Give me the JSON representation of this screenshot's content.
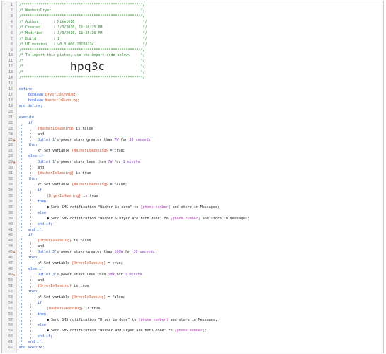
{
  "import_code": "hpq3c",
  "lines": [
    {
      "n": "1",
      "indent": 0,
      "bp": false,
      "parts": [
        {
          "t": "/*********************************************************/",
          "c": "comment"
        }
      ]
    },
    {
      "n": "2",
      "indent": 0,
      "bp": false,
      "parts": [
        {
          "t": "/* Washer/Dryer                                          */",
          "c": "comment"
        }
      ]
    },
    {
      "n": "3",
      "indent": 0,
      "bp": false,
      "parts": [
        {
          "t": "/*********************************************************/",
          "c": "comment"
        }
      ]
    },
    {
      "n": "4",
      "indent": 0,
      "bp": false,
      "parts": [
        {
          "t": "/* Author       : Mike1616                                */",
          "c": "comment"
        }
      ]
    },
    {
      "n": "5",
      "indent": 0,
      "bp": false,
      "parts": [
        {
          "t": "/* Created      : 3/3/2018, 11:16:25 PM                   */",
          "c": "comment"
        }
      ]
    },
    {
      "n": "6",
      "indent": 0,
      "bp": false,
      "parts": [
        {
          "t": "/* Modified     : 3/3/2018, 11:25:16 PM                   */",
          "c": "comment"
        }
      ]
    },
    {
      "n": "7",
      "indent": 0,
      "bp": false,
      "parts": [
        {
          "t": "/* Build        : 1                                       */",
          "c": "comment"
        }
      ]
    },
    {
      "n": "8",
      "indent": 0,
      "bp": false,
      "parts": [
        {
          "t": "/* UI version   : v0.3.000.20180224                       */",
          "c": "comment"
        }
      ]
    },
    {
      "n": "9",
      "indent": 0,
      "bp": false,
      "parts": [
        {
          "t": "/*********************************************************/",
          "c": "comment"
        }
      ]
    },
    {
      "n": "10",
      "indent": 0,
      "bp": false,
      "parts": [
        {
          "t": "/* To import this piston, use the import code below:     */",
          "c": "comment"
        }
      ]
    },
    {
      "n": "11",
      "indent": 0,
      "bp": false,
      "parts": [
        {
          "t": "/*                                                       */",
          "c": "comment"
        }
      ]
    },
    {
      "n": "12",
      "indent": 0,
      "bp": false,
      "parts": [
        {
          "t": "/*                                                       */",
          "c": "comment"
        }
      ]
    },
    {
      "n": "13",
      "indent": 0,
      "bp": false,
      "parts": [
        {
          "t": "/*                                                       */",
          "c": "comment"
        }
      ]
    },
    {
      "n": "14",
      "indent": 0,
      "bp": false,
      "parts": [
        {
          "t": "/*********************************************************/",
          "c": "comment"
        }
      ]
    },
    {
      "n": "15",
      "indent": 0,
      "bp": false,
      "parts": []
    },
    {
      "n": "16",
      "indent": 0,
      "bp": false,
      "parts": [
        {
          "t": "define",
          "c": "kw"
        }
      ]
    },
    {
      "n": "17",
      "indent": 2,
      "bp": false,
      "parts": [
        {
          "t": "boolean ",
          "c": "kw"
        },
        {
          "t": "DryerIsRunning",
          "c": "var"
        },
        {
          "t": ";",
          "c": "text"
        }
      ]
    },
    {
      "n": "18",
      "indent": 2,
      "bp": false,
      "parts": [
        {
          "t": "boolean ",
          "c": "kw"
        },
        {
          "t": "WasherIsRunning",
          "c": "var"
        },
        {
          "t": ";",
          "c": "text"
        }
      ]
    },
    {
      "n": "19",
      "indent": 0,
      "bp": false,
      "parts": [
        {
          "t": "end define;",
          "c": "kw"
        }
      ]
    },
    {
      "n": "20",
      "indent": 0,
      "bp": false,
      "parts": []
    },
    {
      "n": "21",
      "indent": 0,
      "bp": false,
      "parts": [
        {
          "t": "execute",
          "c": "kw"
        }
      ]
    },
    {
      "n": "22",
      "indent": 2,
      "bp": false,
      "parts": [
        {
          "t": "if",
          "c": "kw"
        }
      ]
    },
    {
      "n": "23",
      "indent": 4,
      "bp": false,
      "parts": [
        {
          "t": "{WasherIsRunning}",
          "c": "var"
        },
        {
          "t": " is false",
          "c": "text"
        }
      ]
    },
    {
      "n": "24",
      "indent": 4,
      "bp": false,
      "parts": [
        {
          "t": "and",
          "c": "text"
        }
      ]
    },
    {
      "n": "25",
      "indent": 4,
      "bp": true,
      "parts": [
        {
          "t": "Outlet 1",
          "c": "kw"
        },
        {
          "t": "'s power stays greater than ",
          "c": "text"
        },
        {
          "t": "7W",
          "c": "num"
        },
        {
          "t": " for ",
          "c": "text"
        },
        {
          "t": "30 seconds",
          "c": "num"
        }
      ]
    },
    {
      "n": "26",
      "indent": 2,
      "bp": false,
      "parts": [
        {
          "t": "then",
          "c": "kw"
        }
      ]
    },
    {
      "n": "27",
      "indent": 4,
      "bp": false,
      "parts": [
        {
          "t": "x² Set variable ",
          "c": "text"
        },
        {
          "t": "{WasherIsRunning}",
          "c": "var"
        },
        {
          "t": " = true;",
          "c": "text"
        }
      ]
    },
    {
      "n": "28",
      "indent": 2,
      "bp": false,
      "parts": [
        {
          "t": "else if",
          "c": "kw"
        }
      ]
    },
    {
      "n": "29",
      "indent": 4,
      "bp": true,
      "parts": [
        {
          "t": "Outlet 1",
          "c": "kw"
        },
        {
          "t": "'s power stays less than ",
          "c": "text"
        },
        {
          "t": "7W",
          "c": "num"
        },
        {
          "t": " for ",
          "c": "text"
        },
        {
          "t": "1 minute",
          "c": "num"
        }
      ]
    },
    {
      "n": "30",
      "indent": 4,
      "bp": false,
      "parts": [
        {
          "t": "and",
          "c": "text"
        }
      ]
    },
    {
      "n": "31",
      "indent": 4,
      "bp": false,
      "parts": [
        {
          "t": "{WasherIsRunning}",
          "c": "var"
        },
        {
          "t": " is true",
          "c": "text"
        }
      ]
    },
    {
      "n": "32",
      "indent": 2,
      "bp": false,
      "parts": [
        {
          "t": "then",
          "c": "kw"
        }
      ]
    },
    {
      "n": "33",
      "indent": 4,
      "bp": false,
      "parts": [
        {
          "t": "x² Set variable ",
          "c": "text"
        },
        {
          "t": "{WasherIsRunning}",
          "c": "var"
        },
        {
          "t": " = false;",
          "c": "text"
        }
      ]
    },
    {
      "n": "34",
      "indent": 4,
      "bp": false,
      "parts": [
        {
          "t": "if",
          "c": "kw"
        }
      ]
    },
    {
      "n": "35",
      "indent": 6,
      "bp": false,
      "parts": [
        {
          "t": "{DryerIsRunning}",
          "c": "var"
        },
        {
          "t": " is true",
          "c": "text"
        }
      ]
    },
    {
      "n": "36",
      "indent": 4,
      "bp": false,
      "parts": [
        {
          "t": "then",
          "c": "kw"
        }
      ]
    },
    {
      "n": "37",
      "indent": 6,
      "bp": false,
      "parts": [
        {
          "t": "● Send SMS notification \"Washer is done\" to ",
          "c": "text"
        },
        {
          "t": "[phone number]",
          "c": "arg"
        },
        {
          "t": " and store in Messages;",
          "c": "text"
        }
      ]
    },
    {
      "n": "38",
      "indent": 4,
      "bp": false,
      "parts": [
        {
          "t": "else",
          "c": "kw"
        }
      ]
    },
    {
      "n": "39",
      "indent": 6,
      "bp": false,
      "parts": [
        {
          "t": "● Send SMS notification \"Washer & Dryer are both done\" to ",
          "c": "text"
        },
        {
          "t": "[phone number]",
          "c": "arg"
        },
        {
          "t": " and store in Messages;",
          "c": "text"
        }
      ]
    },
    {
      "n": "40",
      "indent": 4,
      "bp": false,
      "parts": [
        {
          "t": "end if;",
          "c": "kw"
        }
      ]
    },
    {
      "n": "41",
      "indent": 2,
      "bp": false,
      "parts": [
        {
          "t": "end if;",
          "c": "kw"
        }
      ]
    },
    {
      "n": "42",
      "indent": 2,
      "bp": false,
      "parts": [
        {
          "t": "if",
          "c": "kw"
        }
      ]
    },
    {
      "n": "43",
      "indent": 4,
      "bp": false,
      "parts": [
        {
          "t": "{DryerIsRunning}",
          "c": "var"
        },
        {
          "t": " is false",
          "c": "text"
        }
      ]
    },
    {
      "n": "44",
      "indent": 4,
      "bp": false,
      "parts": [
        {
          "t": "and",
          "c": "text"
        }
      ]
    },
    {
      "n": "45",
      "indent": 4,
      "bp": true,
      "parts": [
        {
          "t": "Outlet 3",
          "c": "kw"
        },
        {
          "t": "'s power stays greater than ",
          "c": "text"
        },
        {
          "t": "100W",
          "c": "num"
        },
        {
          "t": " for ",
          "c": "text"
        },
        {
          "t": "30 seconds",
          "c": "num"
        }
      ]
    },
    {
      "n": "46",
      "indent": 2,
      "bp": false,
      "parts": [
        {
          "t": "then",
          "c": "kw"
        }
      ]
    },
    {
      "n": "47",
      "indent": 4,
      "bp": false,
      "parts": [
        {
          "t": "x² Set variable ",
          "c": "text"
        },
        {
          "t": "{DryerIsRunning}",
          "c": "var"
        },
        {
          "t": " = true;",
          "c": "text"
        }
      ]
    },
    {
      "n": "48",
      "indent": 2,
      "bp": false,
      "parts": [
        {
          "t": "else if",
          "c": "kw"
        }
      ]
    },
    {
      "n": "49",
      "indent": 4,
      "bp": true,
      "parts": [
        {
          "t": "Outlet 3",
          "c": "kw"
        },
        {
          "t": "'s power stays less than ",
          "c": "text"
        },
        {
          "t": "10W",
          "c": "num"
        },
        {
          "t": " for ",
          "c": "text"
        },
        {
          "t": "1 minute",
          "c": "num"
        }
      ]
    },
    {
      "n": "50",
      "indent": 4,
      "bp": false,
      "parts": [
        {
          "t": "and",
          "c": "text"
        }
      ]
    },
    {
      "n": "51",
      "indent": 4,
      "bp": false,
      "parts": [
        {
          "t": "{DryerIsRunning}",
          "c": "var"
        },
        {
          "t": " is true",
          "c": "text"
        }
      ]
    },
    {
      "n": "52",
      "indent": 2,
      "bp": false,
      "parts": [
        {
          "t": "then",
          "c": "kw"
        }
      ]
    },
    {
      "n": "53",
      "indent": 4,
      "bp": false,
      "parts": [
        {
          "t": "x² Set variable ",
          "c": "text"
        },
        {
          "t": "{DryerIsRunning}",
          "c": "var"
        },
        {
          "t": " = false;",
          "c": "text"
        }
      ]
    },
    {
      "n": "54",
      "indent": 4,
      "bp": false,
      "parts": [
        {
          "t": "if",
          "c": "kw"
        }
      ]
    },
    {
      "n": "55",
      "indent": 6,
      "bp": false,
      "parts": [
        {
          "t": "{WasherIsRunning}",
          "c": "var"
        },
        {
          "t": " is true",
          "c": "text"
        }
      ]
    },
    {
      "n": "56",
      "indent": 4,
      "bp": false,
      "parts": [
        {
          "t": "then",
          "c": "kw"
        }
      ]
    },
    {
      "n": "57",
      "indent": 6,
      "bp": false,
      "parts": [
        {
          "t": "● Send SMS notification \"Dryer is done\" to ",
          "c": "text"
        },
        {
          "t": "[phone number]",
          "c": "arg"
        },
        {
          "t": " and store in Messages;",
          "c": "text"
        }
      ]
    },
    {
      "n": "58",
      "indent": 4,
      "bp": false,
      "parts": [
        {
          "t": "else",
          "c": "kw"
        }
      ]
    },
    {
      "n": "59",
      "indent": 6,
      "bp": false,
      "parts": [
        {
          "t": "● Send SMS notification \"Washer and Dryer are both done\" to ",
          "c": "text"
        },
        {
          "t": "[phone number]",
          "c": "arg"
        },
        {
          "t": ";",
          "c": "text"
        }
      ]
    },
    {
      "n": "60",
      "indent": 4,
      "bp": false,
      "parts": [
        {
          "t": "end if;",
          "c": "kw"
        }
      ]
    },
    {
      "n": "61",
      "indent": 2,
      "bp": false,
      "parts": [
        {
          "t": "end if;",
          "c": "kw"
        }
      ]
    },
    {
      "n": "62",
      "indent": 0,
      "bp": false,
      "parts": [
        {
          "t": "end execute;",
          "c": "kw"
        }
      ]
    }
  ]
}
